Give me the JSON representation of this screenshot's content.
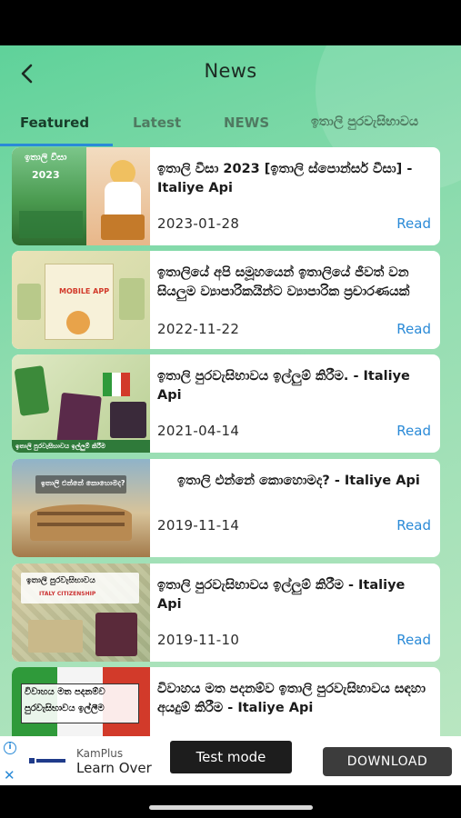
{
  "header": {
    "title": "News",
    "back_icon": "arrow-left-icon"
  },
  "tabs": [
    {
      "label": "Featured",
      "active": true
    },
    {
      "label": "Latest",
      "active": false
    },
    {
      "label": "NEWS",
      "active": false
    },
    {
      "label": "ඉතාලි පුරවැසිභාවය",
      "active": false
    }
  ],
  "articles": [
    {
      "title": "ඉතාලි වීසා 2023 [ඉතාලි ස්පොන්සර් වීසා] - Italiye Api",
      "date": "2023-01-28",
      "read_label": "Read",
      "thumb_text": [
        "ඉතාලි වීසා",
        "2023"
      ]
    },
    {
      "title": "ඉතාලියේ අපි සමූහයෙන් ඉතාලියේ ජීවත් වන සියලුම ව්‍යාපාරිකයින්ට ව්‍යාපාරික ප්‍රචාරණයක්",
      "date": "2022-11-22",
      "read_label": "Read",
      "thumb_text": [
        "MOBILE APP"
      ]
    },
    {
      "title": "ඉතාලි පුරවැසිභාවය ඉල්ලුම් කිරීම. - Italiye Api",
      "date": "2021-04-14",
      "read_label": "Read",
      "thumb_text": [
        "ඉතාලි පුරවැසිභාවය ඉල්ලුම් කිරීම"
      ]
    },
    {
      "title": "ඉතාලි එන්නේ කොහොමද? - Italiye Api",
      "date": "2019-11-14",
      "read_label": "Read",
      "thumb_text": [
        "ඉතාලි එන්නේ කොහොමද?"
      ]
    },
    {
      "title": "ඉතාලි පුරවැසිභාවය ඉල්ලුම් කිරීම - Italiye Api",
      "date": "2019-11-10",
      "read_label": "Read",
      "thumb_text": [
        "ඉතාලි පුරවැසිභාවය",
        "ITALY CITIZENSHIP"
      ]
    },
    {
      "title": "විවාහය මත පදනම්ව ඉතාලි පුරවැසිභාවය සඳහා අයදුම් කිරීම - Italiye Api",
      "date": "",
      "read_label": "",
      "thumb_text": [
        "විවාහය මත පදනම්ව",
        "පුරවැසිභාවය ඉල්ලීම"
      ]
    }
  ],
  "ad": {
    "brand": "KamPlus",
    "headline": "Learn Over",
    "download_label": "DOWNLOAD",
    "test_mode_label": "Test mode",
    "info_icon": "info-icon",
    "close_icon": "close-icon"
  },
  "colors": {
    "accent": "#2a8ad7",
    "background": "#8fdcaf"
  }
}
